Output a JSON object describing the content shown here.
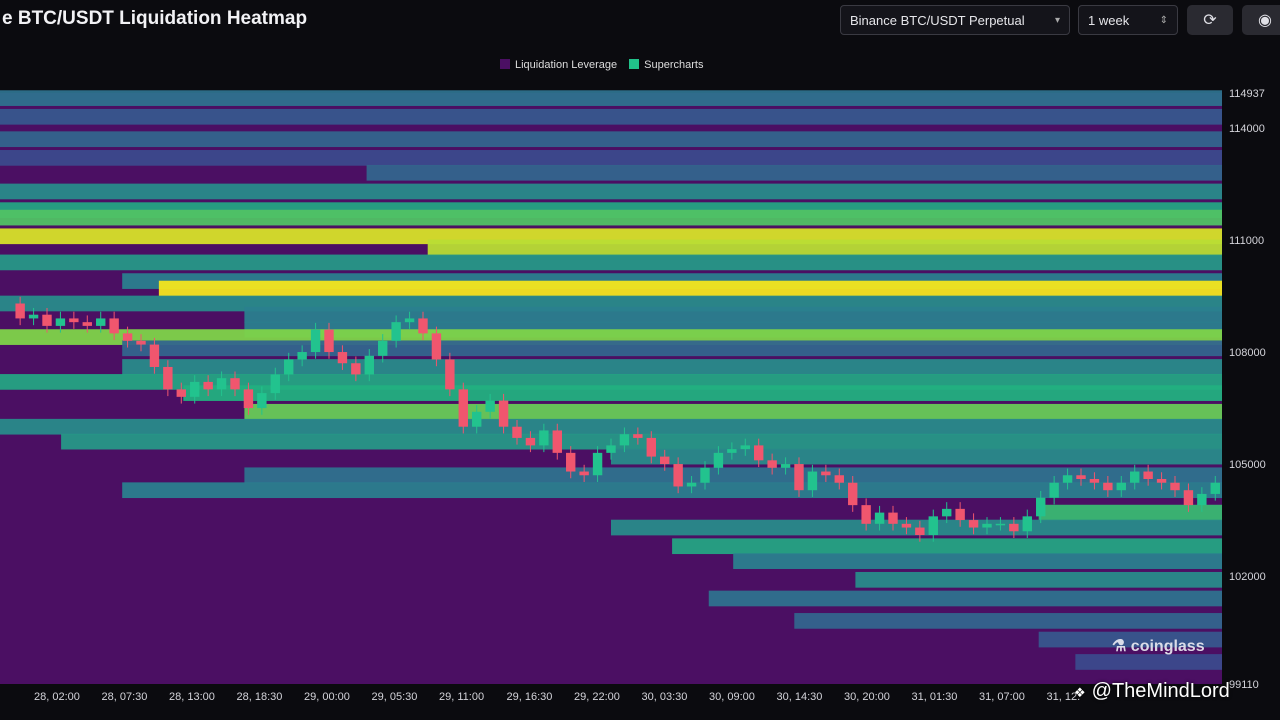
{
  "header": {
    "title": "e BTC/USDT Liquidation Heatmap",
    "pair_select": "Binance BTC/USDT Perpetual",
    "range_select": "1 week"
  },
  "legend": [
    {
      "label": "Liquidation Leverage",
      "color": "#4b0f63"
    },
    {
      "label": "Supercharts",
      "color": "#21c28a"
    }
  ],
  "brand_label": "coinglass",
  "watermark": "@TheMindLord",
  "chart_data": {
    "type": "heatmap",
    "y_ticks": [
      114937,
      114000,
      111000,
      108000,
      105000,
      102000,
      99110
    ],
    "ylim": [
      99110,
      114937
    ],
    "x_ticks": [
      "28, 02:00",
      "28, 07:30",
      "28, 13:00",
      "28, 18:30",
      "29, 00:00",
      "29, 05:30",
      "29, 11:00",
      "29, 16:30",
      "29, 22:00",
      "30, 03:30",
      "30, 09:00",
      "30, 14:30",
      "30, 20:00",
      "31, 01:30",
      "31, 07:00",
      "31, 12:"
    ],
    "colorscale": [
      "#4b0f63",
      "#3b4a8c",
      "#2a7f8e",
      "#22b07f",
      "#7ed449",
      "#f4e61e"
    ],
    "liquidation_bands": [
      {
        "price": 114800,
        "intensity": 0.35,
        "from": 0.0
      },
      {
        "price": 114300,
        "intensity": 0.25,
        "from": 0.0
      },
      {
        "price": 113700,
        "intensity": 0.3,
        "from": 0.0
      },
      {
        "price": 113200,
        "intensity": 0.2,
        "from": 0.0
      },
      {
        "price": 112800,
        "intensity": 0.3,
        "from": 0.3
      },
      {
        "price": 112300,
        "intensity": 0.45,
        "from": 0.0
      },
      {
        "price": 111800,
        "intensity": 0.55,
        "from": 0.0
      },
      {
        "price": 111600,
        "intensity": 0.7,
        "from": 0.0
      },
      {
        "price": 111100,
        "intensity": 0.95,
        "from": 0.0
      },
      {
        "price": 110800,
        "intensity": 0.9,
        "from": 0.35
      },
      {
        "price": 110400,
        "intensity": 0.5,
        "from": 0.0
      },
      {
        "price": 109900,
        "intensity": 0.4,
        "from": 0.1
      },
      {
        "price": 109700,
        "intensity": 1.0,
        "from": 0.13
      },
      {
        "price": 109300,
        "intensity": 0.45,
        "from": 0.0
      },
      {
        "price": 109000,
        "intensity": 0.4,
        "from": 0.2
      },
      {
        "price": 108600,
        "intensity": 0.4,
        "from": 0.2
      },
      {
        "price": 108400,
        "intensity": 0.8,
        "from": 0.0
      },
      {
        "price": 108100,
        "intensity": 0.3,
        "from": 0.1
      },
      {
        "price": 107600,
        "intensity": 0.45,
        "from": 0.1
      },
      {
        "price": 107200,
        "intensity": 0.55,
        "from": 0.0
      },
      {
        "price": 106900,
        "intensity": 0.6,
        "from": 0.15
      },
      {
        "price": 106400,
        "intensity": 0.75,
        "from": 0.2
      },
      {
        "price": 106000,
        "intensity": 0.45,
        "from": 0.0
      },
      {
        "price": 105600,
        "intensity": 0.5,
        "from": 0.05
      },
      {
        "price": 105200,
        "intensity": 0.45,
        "from": 0.5
      },
      {
        "price": 104700,
        "intensity": 0.35,
        "from": 0.2
      },
      {
        "price": 104300,
        "intensity": 0.4,
        "from": 0.1
      },
      {
        "price": 103700,
        "intensity": 0.65,
        "from": 0.85
      },
      {
        "price": 103300,
        "intensity": 0.45,
        "from": 0.5
      },
      {
        "price": 102800,
        "intensity": 0.55,
        "from": 0.55
      },
      {
        "price": 102400,
        "intensity": 0.4,
        "from": 0.6
      },
      {
        "price": 101900,
        "intensity": 0.45,
        "from": 0.7
      },
      {
        "price": 101400,
        "intensity": 0.35,
        "from": 0.58
      },
      {
        "price": 100800,
        "intensity": 0.3,
        "from": 0.65
      },
      {
        "price": 100300,
        "intensity": 0.25,
        "from": 0.85
      },
      {
        "price": 99700,
        "intensity": 0.2,
        "from": 0.88
      }
    ],
    "price_series": [
      109300,
      108900,
      109000,
      108700,
      108900,
      108800,
      108700,
      108900,
      108500,
      108300,
      108200,
      107600,
      107000,
      106800,
      107200,
      107000,
      107300,
      107000,
      106500,
      106900,
      107400,
      107800,
      108000,
      108600,
      108000,
      107700,
      107400,
      107900,
      108300,
      108800,
      108900,
      108500,
      107800,
      107000,
      106000,
      106400,
      106700,
      106000,
      105700,
      105500,
      105900,
      105300,
      104800,
      104700,
      105300,
      105500,
      105800,
      105700,
      105200,
      105000,
      104400,
      104500,
      104900,
      105300,
      105400,
      105500,
      105100,
      104900,
      105000,
      104300,
      104800,
      104700,
      104500,
      103900,
      103400,
      103700,
      103400,
      103300,
      103100,
      103600,
      103800,
      103500,
      103300,
      103400,
      103400,
      103200,
      103600,
      104100,
      104500,
      104700,
      104600,
      104500,
      104300,
      104500,
      104800,
      104600,
      104500,
      104300,
      103900,
      104200,
      104500
    ]
  }
}
